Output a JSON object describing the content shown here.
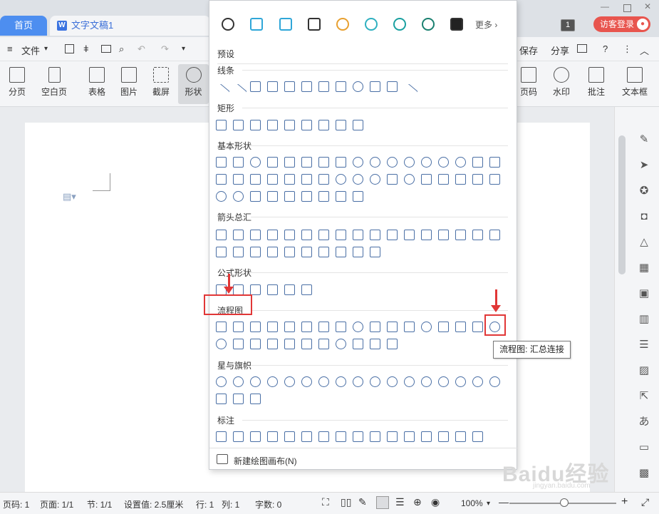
{
  "tabs": {
    "home": "首页",
    "doc": "文字文稿1"
  },
  "window": {
    "login": "访客登录",
    "badge": "1"
  },
  "menu": {
    "file": "文件",
    "save": "保存",
    "share": "分享",
    "help": "?"
  },
  "ribbon": {
    "left": [
      "分页",
      "空白页",
      "表格",
      "图片",
      "截屏",
      "形状"
    ],
    "right": [
      "页码",
      "水印",
      "批注",
      "文本框"
    ]
  },
  "panel": {
    "more": "更多",
    "sections": [
      "预设",
      "线条",
      "矩形",
      "基本形状",
      "箭头总汇",
      "公式形状",
      "流程图",
      "星与旗帜",
      "标注"
    ],
    "tooltip": "流程图: 汇总连接",
    "new_canvas": "新建绘图画布(N)"
  },
  "status": {
    "page": "页码: 1",
    "pages": "页面: 1/1",
    "section": "节: 1/1",
    "setting": "设置值: 2.5厘米",
    "row": "行: 1",
    "col": "列: 1",
    "words": "字数: 0",
    "zoom": "100%"
  },
  "watermark": {
    "main": "Baidu经验",
    "sub": "jingyan.baidu.com"
  }
}
